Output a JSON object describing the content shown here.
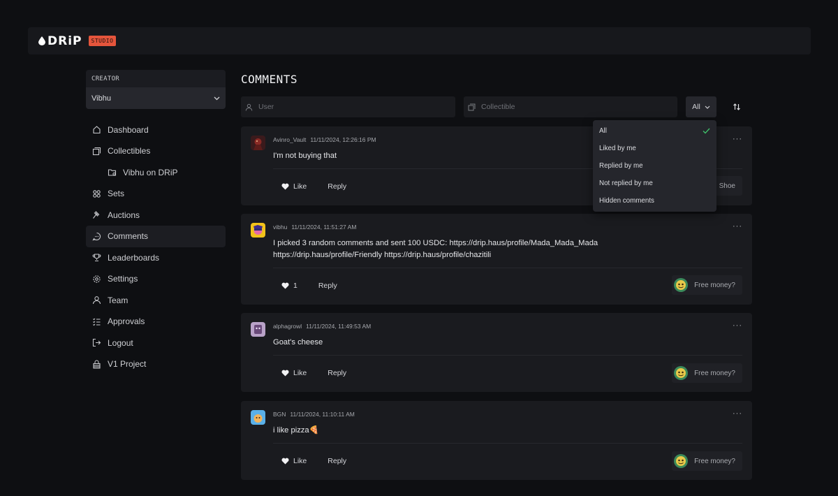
{
  "app": {
    "logo_text": "DRiP",
    "badge": "STUDIO"
  },
  "sidebar": {
    "creator_label": "CREATOR",
    "creator_value": "Vibhu",
    "items": [
      {
        "label": "Dashboard",
        "icon": "home-icon"
      },
      {
        "label": "Collectibles",
        "icon": "collectibles-icon"
      },
      {
        "label": "Vibhu on DRiP",
        "icon": "folder-icon"
      },
      {
        "label": "Sets",
        "icon": "sets-icon"
      },
      {
        "label": "Auctions",
        "icon": "gavel-icon"
      },
      {
        "label": "Comments",
        "icon": "comment-icon"
      },
      {
        "label": "Leaderboards",
        "icon": "trophy-icon"
      },
      {
        "label": "Settings",
        "icon": "gear-icon"
      },
      {
        "label": "Team",
        "icon": "user-icon"
      },
      {
        "label": "Approvals",
        "icon": "checklist-icon"
      },
      {
        "label": "Logout",
        "icon": "logout-icon"
      },
      {
        "label": "V1 Project",
        "icon": "lock-icon"
      }
    ],
    "active": "Comments"
  },
  "main": {
    "title": "COMMENTS",
    "user_placeholder": "User",
    "collectible_placeholder": "Collectible",
    "filter_value": "All"
  },
  "dropdown": {
    "options": [
      "All",
      "Liked by me",
      "Replied by me",
      "Not replied by me",
      "Hidden comments"
    ],
    "selected": "All"
  },
  "comments": [
    {
      "user": "Avinro_Vault",
      "time": "11/11/2024, 12:26:16 PM",
      "text": "I'm not buying that",
      "like_label": "Like",
      "reply_label": "Reply",
      "collectible": "Shoe"
    },
    {
      "user": "vibhu",
      "time": "11/11/2024, 11:51:27 AM",
      "text": "I picked 3 random comments and sent 100 USDC: https://drip.haus/profile/Mada_Mada_Mada https://drip.haus/profile/Friendly https://drip.haus/profile/chazitili",
      "like_label": "1",
      "reply_label": "Reply",
      "collectible": "Free money?"
    },
    {
      "user": "alphagrowl",
      "time": "11/11/2024, 11:49:53 AM",
      "text": "Goat's cheese",
      "like_label": "Like",
      "reply_label": "Reply",
      "collectible": "Free money?"
    },
    {
      "user": "BGN",
      "time": "11/11/2024, 11:10:11 AM",
      "text": "i like pizza🍕",
      "like_label": "Like",
      "reply_label": "Reply",
      "collectible": "Free money?"
    }
  ],
  "colors": {
    "background": "#0e0f12",
    "panel": "#1a1b1f",
    "accent_badge": "#e5553c",
    "check_green": "#3fbf6a"
  }
}
